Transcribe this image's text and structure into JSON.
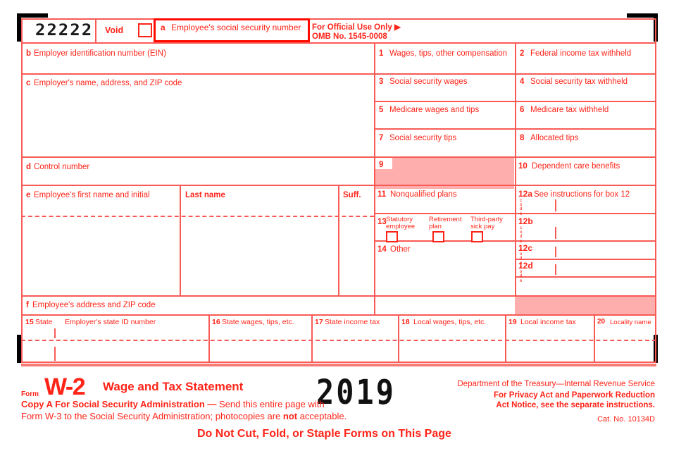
{
  "form": {
    "control_number_ocr": "22222",
    "void_label": "Void",
    "box_a": {
      "letter": "a",
      "label": "Employee's social security number"
    },
    "official_use": {
      "line1": "For Official Use Only ▶",
      "line2": "OMB No. 1545-0008"
    },
    "box_b": {
      "letter": "b",
      "label": "Employer identification number (EIN)"
    },
    "box_c": {
      "letter": "c",
      "label": "Employer's name, address, and ZIP code"
    },
    "box_d": {
      "letter": "d",
      "label": "Control number"
    },
    "box_e": {
      "letter": "e",
      "label": "Employee's first name and initial",
      "last_name": "Last name",
      "suffix": "Suff."
    },
    "box_f": {
      "letter": "f",
      "label": "Employee's address and ZIP code"
    },
    "numbered_boxes": [
      {
        "num": "1",
        "label": "Wages, tips, other compensation"
      },
      {
        "num": "2",
        "label": "Federal income tax withheld"
      },
      {
        "num": "3",
        "label": "Social security wages"
      },
      {
        "num": "4",
        "label": "Social security tax withheld"
      },
      {
        "num": "5",
        "label": "Medicare wages and tips"
      },
      {
        "num": "6",
        "label": "Medicare tax withheld"
      },
      {
        "num": "7",
        "label": "Social security tips"
      },
      {
        "num": "8",
        "label": "Allocated tips"
      },
      {
        "num": "9",
        "label": ""
      },
      {
        "num": "10",
        "label": "Dependent care benefits"
      },
      {
        "num": "11",
        "label": "Nonqualified plans"
      },
      {
        "num": "12a",
        "label": "See instructions for box 12"
      },
      {
        "num": "12b",
        "label": ""
      },
      {
        "num": "12c",
        "label": ""
      },
      {
        "num": "12d",
        "label": ""
      },
      {
        "num": "13",
        "label": ""
      },
      {
        "num": "14",
        "label": "Other"
      },
      {
        "num": "15",
        "label": "State"
      },
      {
        "num": "16",
        "label": "State wages, tips, etc."
      },
      {
        "num": "17",
        "label": "State income tax"
      },
      {
        "num": "18",
        "label": "Local wages, tips, etc."
      },
      {
        "num": "19",
        "label": "Local income tax"
      },
      {
        "num": "20",
        "label": "Locality name"
      }
    ],
    "box_13_checkboxes": [
      {
        "line1": "Statutory",
        "line2": "employee"
      },
      {
        "line1": "Retirement",
        "line2": "plan"
      },
      {
        "line1": "Third-party",
        "line2": "sick pay"
      }
    ],
    "code_label_letters": [
      "c",
      "o",
      "d",
      "e"
    ],
    "employer_state_id": "Employer's state ID number",
    "footer": {
      "form_word": "Form",
      "form_name": "W-2",
      "form_title": "Wage and Tax Statement",
      "year": "2019",
      "copy_a_bold": "Copy A For Social Security Administration —",
      "copy_a_rest": " Send this entire page with",
      "copy_a_line2_pre": "Form W-3 to the Social Security Administration; photocopies are ",
      "copy_a_line2_bold": "not",
      "copy_a_line2_post": " acceptable.",
      "treasury": "Department of the Treasury—Internal Revenue Service",
      "privacy_line1": "For Privacy Act and Paperwork Reduction",
      "privacy_line2": "Act Notice, see the separate instructions.",
      "cat_no": "Cat. No. 10134D",
      "do_not_cut": "Do Not Cut, Fold, or Staple Forms on This Page"
    },
    "colors": {
      "red": "#FF2418",
      "red_line": "#FA5A55",
      "shade": "#FFAEAE"
    }
  }
}
